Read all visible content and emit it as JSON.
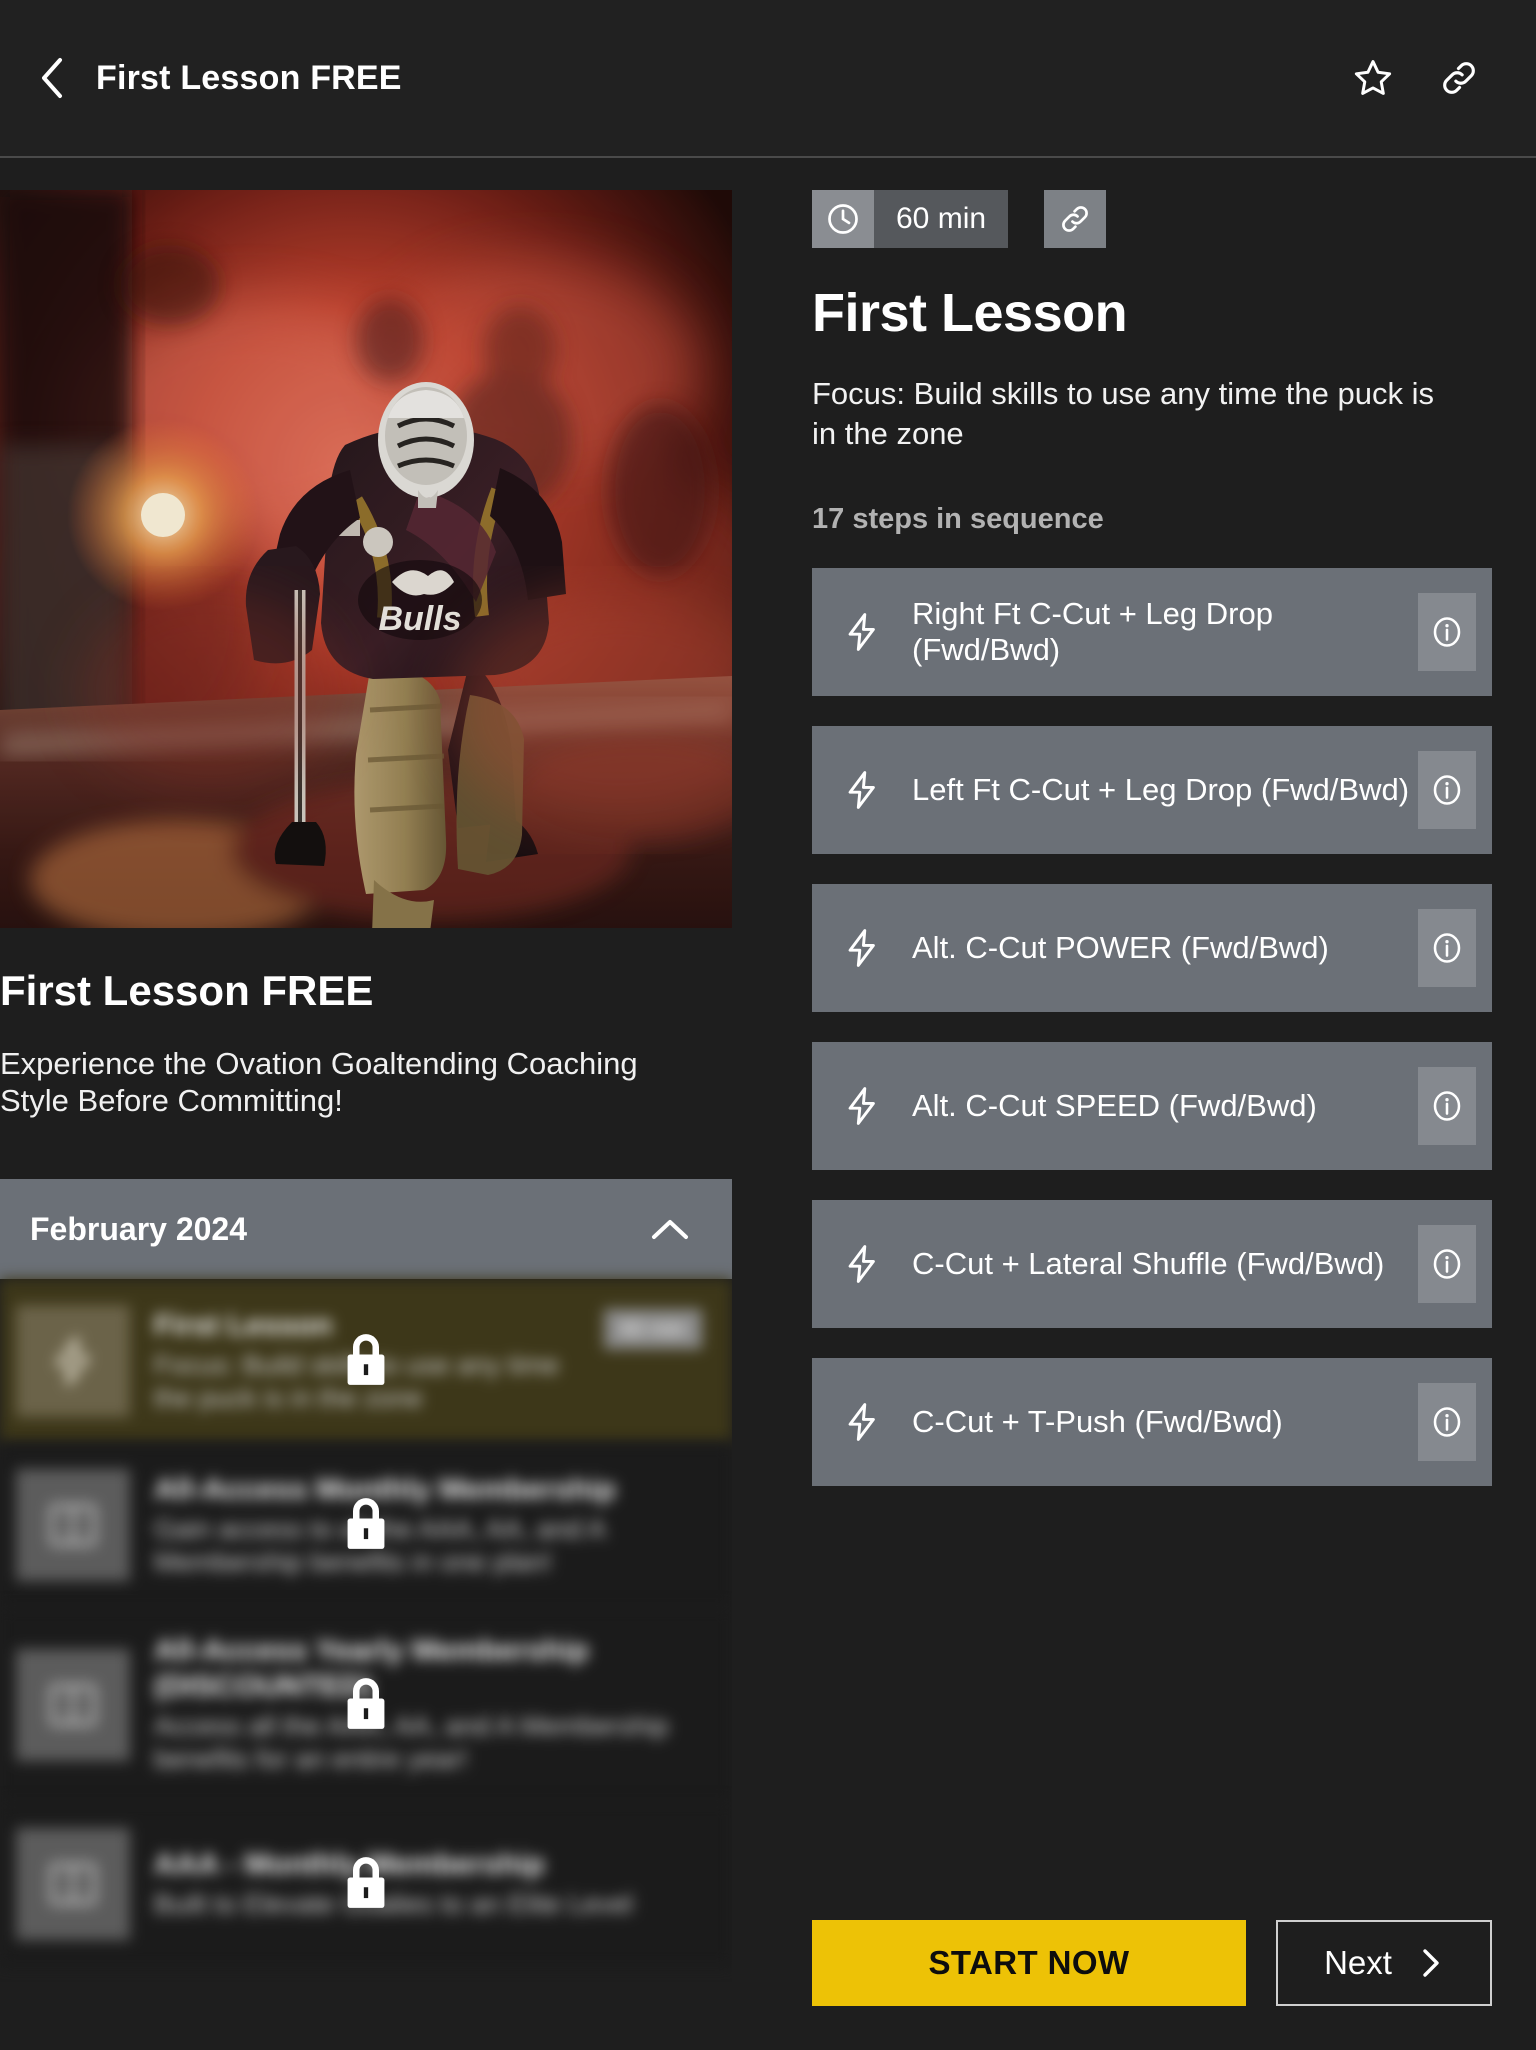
{
  "topbar": {
    "title": "First Lesson FREE",
    "back_icon": "chevron-left-icon",
    "favorite_icon": "star-icon",
    "share_icon": "link-icon"
  },
  "left": {
    "hero_alt": "hockey-goalie-red-smoke",
    "title": "First Lesson FREE",
    "subtitle": "Experience the Ovation Goaltending Coaching Style Before Committing!",
    "accordion": {
      "label": "February 2024",
      "toggle_icon": "chevron-up-icon",
      "expanded": true
    },
    "locked_items": [
      {
        "icon": "lightning-bolt-icon",
        "title": "First Lesson",
        "desc": "Focus: Build skills to use any time the puck is in the zone",
        "badge": "60 min",
        "locked": true,
        "highlighted": true
      },
      {
        "icon": "book-icon",
        "title": "All-Access Monthly Membership",
        "desc": "Gain access to all the AAA, AA, and A Membership benefits in one plan!",
        "badge": "",
        "locked": true,
        "highlighted": false
      },
      {
        "icon": "book-icon",
        "title": "All-Access Yearly Membership (DISCOUNTED)",
        "desc": "Access all the AAA, AA, and A Membership benefits for an entire year!",
        "badge": "",
        "locked": true,
        "highlighted": false
      },
      {
        "icon": "book-icon",
        "title": "AAA - Monthly Membership",
        "desc": "Built to Elevate Goalies to an Elite Level",
        "badge": "",
        "locked": true,
        "highlighted": false
      }
    ]
  },
  "right": {
    "duration": "60 min",
    "duration_icon": "clock-icon",
    "share_icon": "link-icon",
    "title": "First Lesson",
    "focus": "Focus: Build skills to use any time the puck is in the zone",
    "steps_count_label": "17 steps in sequence",
    "steps": [
      {
        "icon": "lightning-bolt-icon",
        "label": "Right Ft C-Cut + Leg Drop (Fwd/Bwd)",
        "info_icon": "info-icon"
      },
      {
        "icon": "lightning-bolt-icon",
        "label": "Left Ft C-Cut + Leg Drop (Fwd/Bwd)",
        "info_icon": "info-icon"
      },
      {
        "icon": "lightning-bolt-icon",
        "label": "Alt. C-Cut POWER (Fwd/Bwd)",
        "info_icon": "info-icon"
      },
      {
        "icon": "lightning-bolt-icon",
        "label": "Alt. C-Cut SPEED (Fwd/Bwd)",
        "info_icon": "info-icon"
      },
      {
        "icon": "lightning-bolt-icon",
        "label": "C-Cut + Lateral Shuffle (Fwd/Bwd)",
        "info_icon": "info-icon"
      },
      {
        "icon": "lightning-bolt-icon",
        "label": "C-Cut + T-Push (Fwd/Bwd)",
        "info_icon": "info-icon"
      }
    ]
  },
  "actions": {
    "start_label": "START NOW",
    "next_label": "Next",
    "next_icon": "chevron-right-icon"
  },
  "colors": {
    "page_bg": "#1e1e1e",
    "topbar_bg": "#212121",
    "card_bg": "#6b7077",
    "accent_yellow": "#edc206",
    "muted_text": "#b2b2b2",
    "highlight_row": "#3d3719"
  }
}
